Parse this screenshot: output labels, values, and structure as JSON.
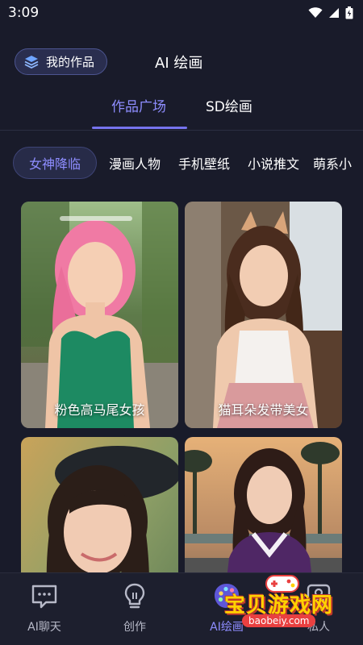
{
  "status_bar": {
    "time": "3:09"
  },
  "header": {
    "my_works_label": "我的作品",
    "title": "AI 绘画"
  },
  "main_tabs": [
    {
      "label": "作品广场",
      "active": true
    },
    {
      "label": "SD绘画",
      "active": false
    }
  ],
  "categories": [
    {
      "label": "女神降临",
      "active": true
    },
    {
      "label": "漫画人物"
    },
    {
      "label": "手机壁纸"
    },
    {
      "label": "小说推文"
    },
    {
      "label": "萌系小"
    }
  ],
  "gallery": [
    {
      "caption": "粉色高马尾女孩"
    },
    {
      "caption": "猫耳朵发带美女"
    },
    {
      "caption": ""
    },
    {
      "caption": ""
    }
  ],
  "bottom_nav": [
    {
      "label": "AI聊天",
      "icon": "chat-bubble-icon"
    },
    {
      "label": "创作",
      "icon": "lightbulb-icon"
    },
    {
      "label": "AI绘画",
      "icon": "palette-icon",
      "active": true
    },
    {
      "label": "私人",
      "icon": "person-icon"
    }
  ],
  "watermark": {
    "title": "宝贝游戏网",
    "url": "baobeiy.com"
  },
  "colors": {
    "background": "#191b2a",
    "accent": "#8e8dff",
    "nav_bg": "#1d1f2e",
    "chip_bg": "#272b48"
  }
}
